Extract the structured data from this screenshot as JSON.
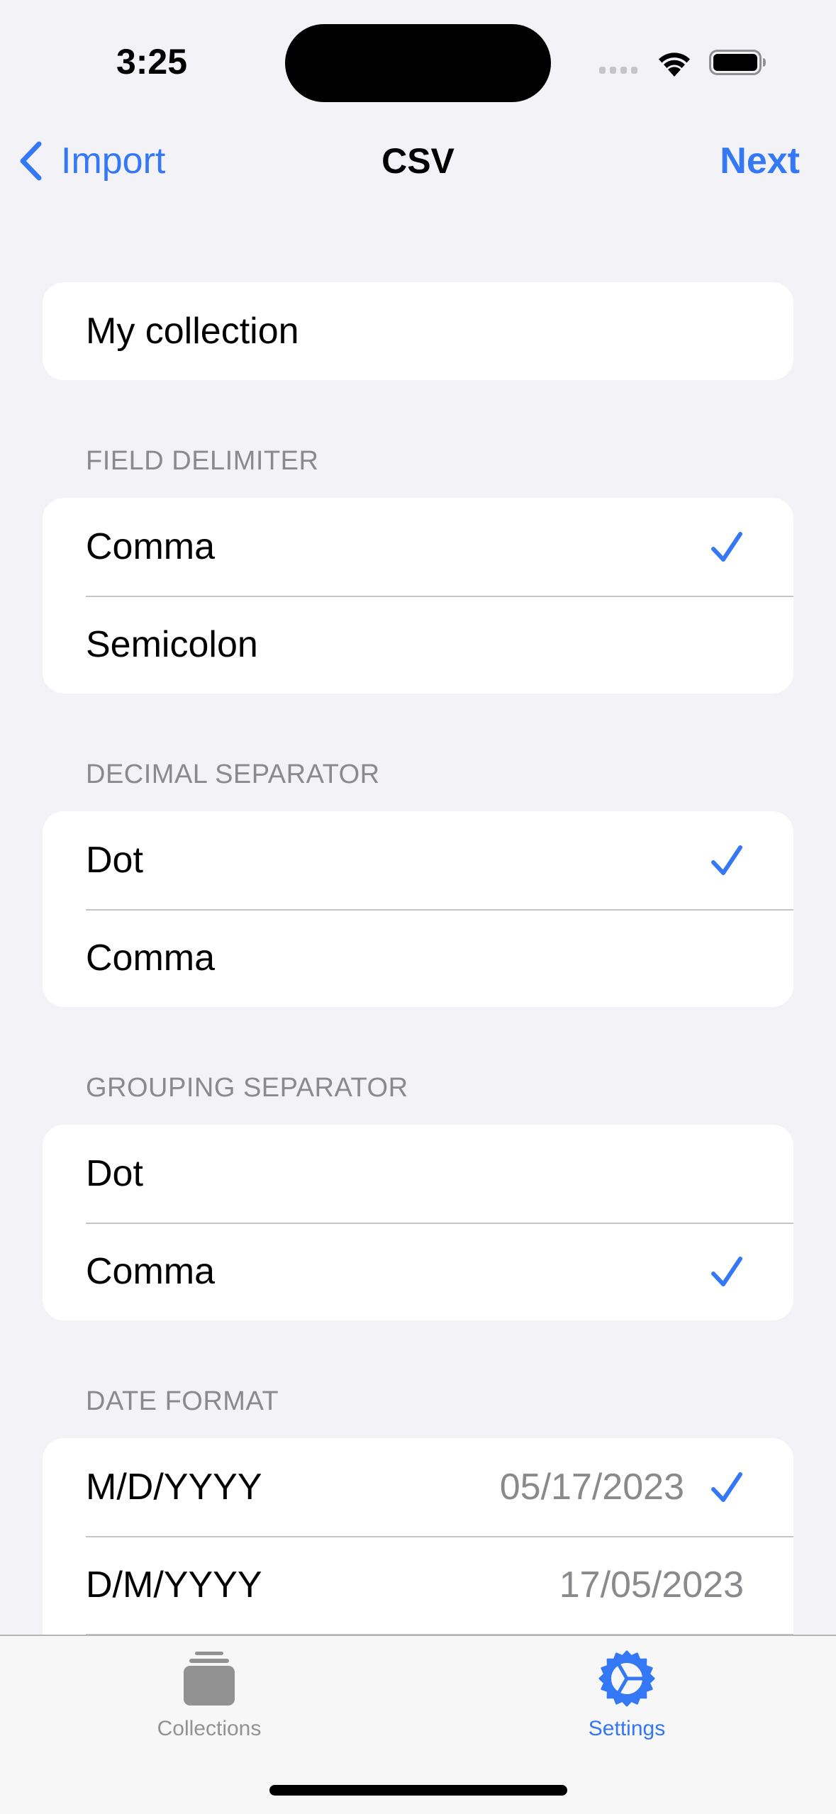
{
  "status_bar": {
    "time": "3:25",
    "icons": [
      "cellular-signal-icon",
      "wifi-icon",
      "battery-icon"
    ]
  },
  "nav": {
    "back_label": "Import",
    "back_icon": "chevron-left-icon",
    "title": "CSV",
    "next_label": "Next"
  },
  "collection_name": {
    "value": "My collection"
  },
  "sections": {
    "field_delimiter": {
      "header": "FIELD DELIMITER",
      "options": [
        {
          "label": "Comma",
          "selected": true
        },
        {
          "label": "Semicolon",
          "selected": false
        }
      ]
    },
    "decimal_separator": {
      "header": "DECIMAL SEPARATOR",
      "options": [
        {
          "label": "Dot",
          "selected": true
        },
        {
          "label": "Comma",
          "selected": false
        }
      ]
    },
    "grouping_separator": {
      "header": "GROUPING SEPARATOR",
      "options": [
        {
          "label": "Dot",
          "selected": false
        },
        {
          "label": "Comma",
          "selected": true
        }
      ]
    },
    "date_format": {
      "header": "DATE FORMAT",
      "options": [
        {
          "label": "M/D/YYYY",
          "example": "05/17/2023",
          "selected": true
        },
        {
          "label": "D/M/YYYY",
          "example": "17/05/2023",
          "selected": false
        }
      ]
    }
  },
  "tab_bar": {
    "tabs": [
      {
        "label": "Collections",
        "icon": "collections-stack-icon",
        "active": false
      },
      {
        "label": "Settings",
        "icon": "gear-icon",
        "active": true
      }
    ]
  },
  "colors": {
    "accent": "#3478F6",
    "background": "#F2F2F7",
    "card": "#FFFFFF",
    "secondary_text": "#8A8A8E",
    "separator": "#C6C6C8",
    "tab_inactive": "#929292"
  }
}
